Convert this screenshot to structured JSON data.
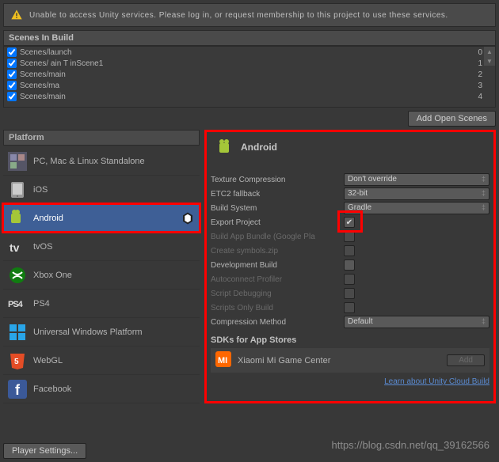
{
  "warning": {
    "text": "Unable to access Unity services. Please log in, or request membership to this project to use these services."
  },
  "scenes": {
    "header": "Scenes In Build",
    "items": [
      {
        "name": "Scenes/launch",
        "idx": "0"
      },
      {
        "name": "Scenes/  ain      T    inScene1",
        "idx": "1"
      },
      {
        "name": "Scenes/main",
        "idx": "2"
      },
      {
        "name": "Scenes/ma",
        "idx": "3"
      },
      {
        "name": "Scenes/main",
        "idx": "4"
      }
    ],
    "add_btn": "Add Open Scenes"
  },
  "platforms": {
    "header": "Platform",
    "items": [
      {
        "label": "PC, Mac & Linux Standalone"
      },
      {
        "label": "iOS"
      },
      {
        "label": "Android"
      },
      {
        "label": "tvOS"
      },
      {
        "label": "Xbox One"
      },
      {
        "label": "PS4"
      },
      {
        "label": "Universal Windows Platform"
      },
      {
        "label": "WebGL"
      },
      {
        "label": "Facebook"
      }
    ]
  },
  "settings": {
    "title": "Android",
    "rows": {
      "texture_compression": {
        "label": "Texture Compression",
        "value": "Don't override"
      },
      "etc2_fallback": {
        "label": "ETC2 fallback",
        "value": "32-bit"
      },
      "build_system": {
        "label": "Build System",
        "value": "Gradle"
      },
      "export_project": {
        "label": "Export Project",
        "checked": true
      },
      "build_app_bundle": {
        "label": "Build App Bundle (Google Pla"
      },
      "create_symbols": {
        "label": "Create symbols.zip"
      },
      "development_build": {
        "label": "Development Build"
      },
      "autoconnect": {
        "label": "Autoconnect Profiler"
      },
      "script_debug": {
        "label": "Script Debugging"
      },
      "scripts_only": {
        "label": "Scripts Only Build"
      },
      "compression_method": {
        "label": "Compression Method",
        "value": "Default"
      }
    },
    "sdks_header": "SDKs for App Stores",
    "sdk": {
      "name": "Xiaomi Mi Game Center",
      "add_btn": "Add"
    },
    "cloud_link": "Learn about Unity Cloud Build"
  },
  "footer": {
    "player_settings": "Player Settings..."
  },
  "watermark": "https://blog.csdn.net/qq_39162566"
}
